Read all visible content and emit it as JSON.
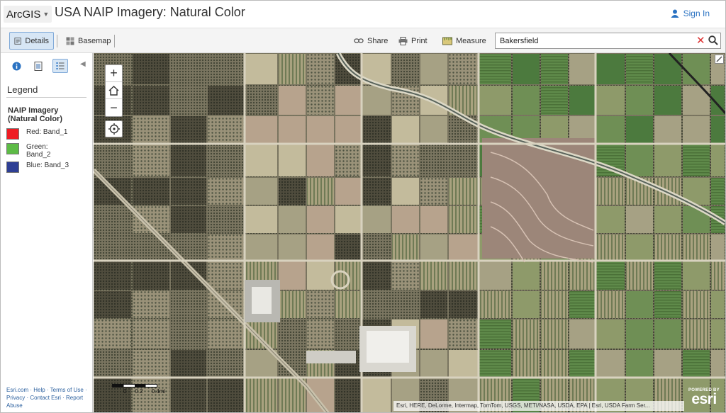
{
  "header": {
    "arcgis_label": "ArcGIS",
    "title": "USA NAIP Imagery: Natural Color",
    "signin_label": "Sign In"
  },
  "toolbar": {
    "details_label": "Details",
    "basemap_label": "Basemap",
    "share_label": "Share",
    "print_label": "Print",
    "measure_label": "Measure",
    "search_value": "Bakersfield"
  },
  "panel": {
    "legend_heading": "Legend",
    "layer_title": "NAIP Imagery (Natural Color)",
    "legend_items": [
      {
        "label": "Red: Band_1",
        "color": "#ee1c24"
      },
      {
        "label": "Green: Band_2",
        "color": "#5dbb46"
      },
      {
        "label": "Blue: Band_3",
        "color": "#2e3f94"
      }
    ],
    "footer_links": [
      "Esri.com",
      "Help",
      "Terms of Use",
      "Privacy",
      "Contact Esri",
      "Report Abuse"
    ]
  },
  "map": {
    "scale_labels": [
      "0",
      "0.2",
      "0.4mi"
    ],
    "attribution": "Esri, HERE, DeLorme, Intermap, TomTom, USGS, METI/NASA, USDA, EPA | Esri, USDA Farm Ser...",
    "logo_powered": "POWERED BY",
    "logo_word": "esri"
  },
  "colors": {
    "accent": "#2a72c2",
    "active_tab_bg": "#d7e6f5"
  }
}
